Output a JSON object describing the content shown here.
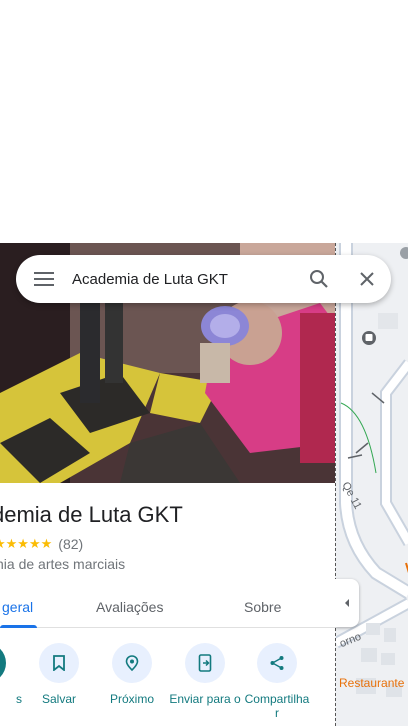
{
  "search": {
    "query": "Academia de Luta GKT",
    "menu_icon": "menu-icon",
    "search_icon": "search-icon",
    "close_icon": "close-icon"
  },
  "place": {
    "title": "demia de Luta GKT",
    "stars": "★★★★★",
    "rating_value": 5,
    "review_count": "(82)",
    "category": "nia de artes marciais"
  },
  "tabs": [
    {
      "label": "geral",
      "active": true
    },
    {
      "label": "Avaliações",
      "active": false
    },
    {
      "label": "Sobre",
      "active": false
    }
  ],
  "actions": [
    {
      "label": "s",
      "icon": "directions-icon"
    },
    {
      "label": "Salvar",
      "icon": "bookmark-icon"
    },
    {
      "label": "Próximo",
      "icon": "nearby-icon"
    },
    {
      "label": "Enviar para o",
      "icon": "send-to-phone-icon"
    },
    {
      "label": "Compartilha r",
      "icon": "share-icon"
    }
  ],
  "map": {
    "road_label": "Qe 11",
    "road_label_2": "orno",
    "poi_label": "Restaurante"
  },
  "colors": {
    "accent": "#1a73e8",
    "action": "#137a7f",
    "star": "#fbbc04"
  }
}
